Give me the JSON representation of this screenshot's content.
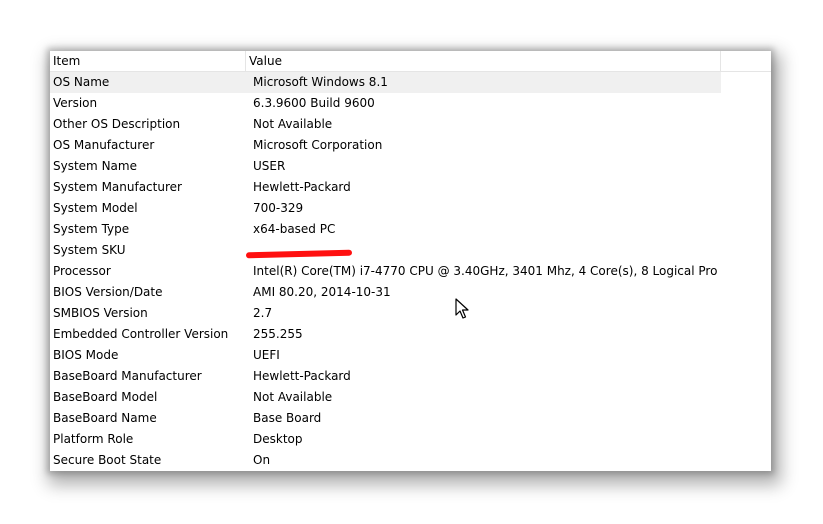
{
  "columns": {
    "item": "Item",
    "value": "Value"
  },
  "rows": [
    {
      "item": "OS Name",
      "value": "Microsoft Windows 8.1"
    },
    {
      "item": "Version",
      "value": "6.3.9600 Build 9600"
    },
    {
      "item": "Other OS Description",
      "value": "Not Available"
    },
    {
      "item": "OS Manufacturer",
      "value": "Microsoft Corporation"
    },
    {
      "item": "System Name",
      "value": "USER"
    },
    {
      "item": "System Manufacturer",
      "value": "Hewlett-Packard"
    },
    {
      "item": "System Model",
      "value": "700-329"
    },
    {
      "item": "System Type",
      "value": "x64-based PC"
    },
    {
      "item": "System SKU",
      "value": ""
    },
    {
      "item": "Processor",
      "value": "Intel(R) Core(TM) i7-4770 CPU @ 3.40GHz, 3401 Mhz, 4 Core(s), 8 Logical Pro..."
    },
    {
      "item": "BIOS Version/Date",
      "value": "AMI 80.20, 2014-10-31"
    },
    {
      "item": "SMBIOS Version",
      "value": "2.7"
    },
    {
      "item": "Embedded Controller Version",
      "value": "255.255"
    },
    {
      "item": "BIOS Mode",
      "value": "UEFI"
    },
    {
      "item": "BaseBoard Manufacturer",
      "value": "Hewlett-Packard"
    },
    {
      "item": "BaseBoard Model",
      "value": "Not Available"
    },
    {
      "item": "BaseBoard Name",
      "value": "Base Board"
    },
    {
      "item": "Platform Role",
      "value": "Desktop"
    },
    {
      "item": "Secure Boot State",
      "value": "On"
    }
  ],
  "colors": {
    "selected_row": "#f0f0f0",
    "redaction": "#ff1010",
    "grid": "#e5e5e5"
  },
  "icons": {
    "cursor": "mouse-pointer-icon"
  }
}
